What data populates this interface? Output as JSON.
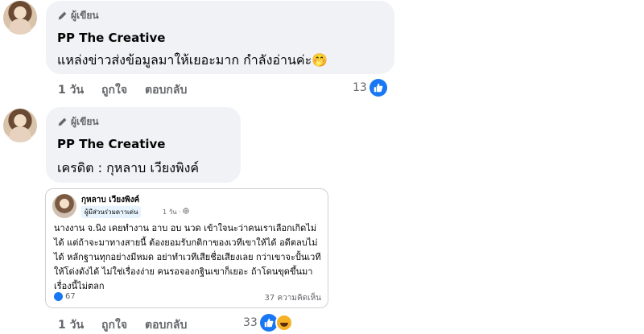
{
  "comment1": {
    "author_tag": "ผู้เขียน",
    "name": "PP The Creative",
    "text": "แหล่งข่าวส่งข้อมูลมาให้เยอะมาก กำลังอ่านค่ะ",
    "emoji": "🤭",
    "time": "1 วัน",
    "like_label": "ถูกใจ",
    "reply_label": "ตอบกลับ",
    "reaction_count": "13"
  },
  "comment2": {
    "author_tag": "ผู้เขียน",
    "name": "PP The Creative",
    "text": "เครดิต : กุหลาบ เวียงพิงค์",
    "time": "1 วัน",
    "like_label": "ถูกใจ",
    "reply_label": "ตอบกลับ",
    "reaction_count": "33"
  },
  "embedded_post": {
    "name": "กุหลาบ เวียงพิงค์",
    "badge": "ผู้มีส่วนร่วมดาวเด่น",
    "time": "1 วัน · ",
    "body": "นางงาน จ.นิง เคยทำงาน อาบ อบ นวด เข้าใจนะว่าคนเราเลือกเกิดไม่ได้ แต่ถ้าจะมาทางสายนี้ ต้องยอมรับกติกาของเวทีเขาให้ได้ อดีตลบไม่ได้ หลักฐานทุกอย่างมีหมด อย่าทำเวทีเสียชื่อเสียงเลย กว่าเขาจะปั้นเวทีให้โด่งดังได้ ไม่ใช่เรื่องง่าย คนรอจองกฐินเขาก็เยอะ ถ้าโดนขุดขึ้นมา เรื่องนี้ไม่ตลก",
    "likes": "67",
    "comments": "37 ความคิดเห็น"
  },
  "colors": {
    "bubble": "#f0f2f5",
    "like_blue": "#1877f2",
    "secondary_text": "#65676b"
  },
  "icons": [
    "pen-icon",
    "like-icon",
    "haha-icon",
    "globe-icon"
  ]
}
